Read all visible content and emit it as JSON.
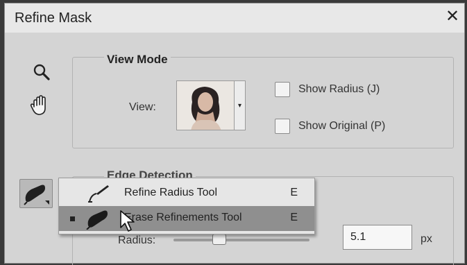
{
  "dialog": {
    "title": "Refine Mask",
    "close_glyph": "✕"
  },
  "tools": {
    "zoom": "zoom-icon",
    "hand": "hand-icon"
  },
  "view_mode": {
    "section_title": "View Mode",
    "view_label": "View:",
    "thumbnail": "portrait-thumbnail",
    "dropdown_glyph": "▾",
    "show_radius_label": "Show Radius (J)",
    "show_radius_checked": false,
    "show_original_label": "Show Original (P)",
    "show_original_checked": false
  },
  "edge_detection": {
    "title_partial": "Edge Detection",
    "radius_label": "Radius:",
    "radius_value": "5.1",
    "radius_unit": "px"
  },
  "flyout": {
    "items": [
      {
        "label": "Refine Radius Tool",
        "shortcut": "E",
        "selected": false
      },
      {
        "label": "Erase Refinements Tool",
        "shortcut": "E",
        "selected": true
      }
    ]
  },
  "colors": {
    "dialog_bg": "#d4d4d4",
    "titlebar_bg": "#e8e8e8",
    "selected_item_bg": "#8f8f8f"
  }
}
